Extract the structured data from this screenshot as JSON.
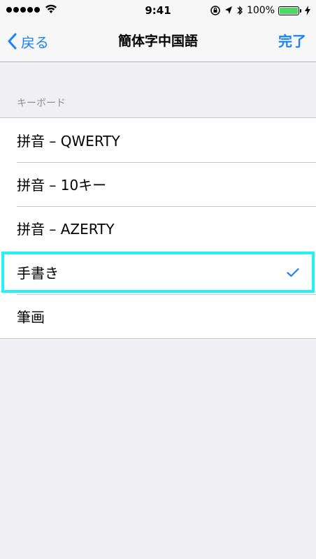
{
  "status_bar": {
    "time": "9:41",
    "battery_percent": "100%",
    "icons": [
      "signal-dots-icon",
      "wifi-icon",
      "orientation-lock-icon",
      "location-arrow-icon",
      "bluetooth-icon",
      "battery-icon",
      "charging-bolt-icon"
    ]
  },
  "nav": {
    "back_label": "戻る",
    "title": "簡体字中国語",
    "done_label": "完了"
  },
  "section": {
    "header": "キーボード",
    "items": [
      {
        "label": "拼音 – QWERTY",
        "selected": false
      },
      {
        "label": "拼音 – 10キー",
        "selected": false
      },
      {
        "label": "拼音 – AZERTY",
        "selected": false
      },
      {
        "label": "手書き",
        "selected": true
      },
      {
        "label": "筆画",
        "selected": false
      }
    ]
  },
  "colors": {
    "accent": "#1a82fb",
    "highlight": "#24f1f3",
    "battery": "#4cd964",
    "background": "#efeff4"
  }
}
